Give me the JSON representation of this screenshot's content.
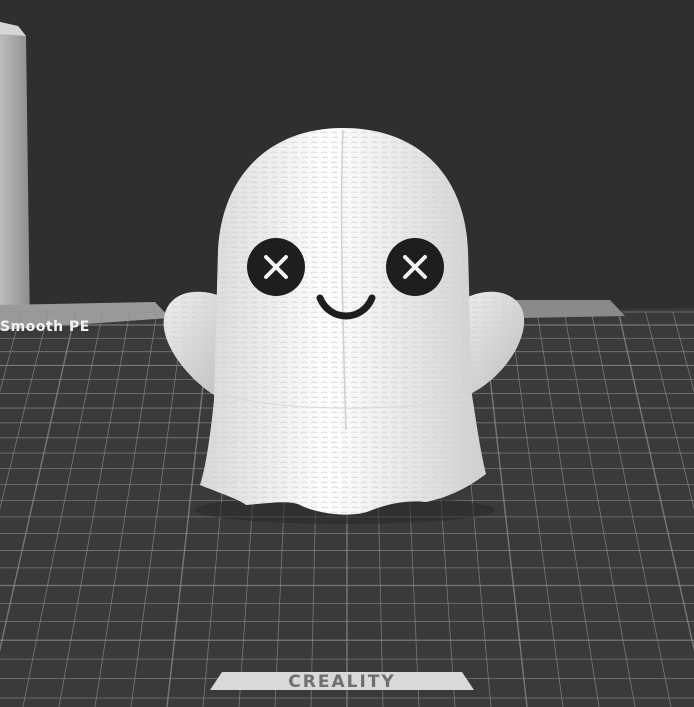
{
  "viewport": {
    "background_color": "#2f2f31",
    "bed_color": "#3a3a3c",
    "grid_color": "#8c8c8e",
    "model_color": "#f4f4f4",
    "model_accent_color": "#1e1e20"
  },
  "bed": {
    "plate_label": "Smooth PE",
    "brand_label": "CREALITY"
  },
  "model": {
    "name_icon": "ghost-model"
  }
}
